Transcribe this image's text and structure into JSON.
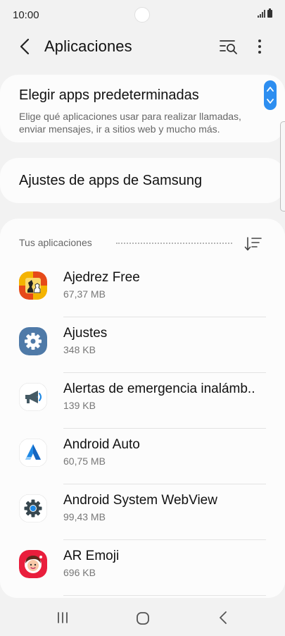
{
  "status_bar": {
    "time": "10:00"
  },
  "header": {
    "back_icon": "back-arrow-icon",
    "title": "Aplicaciones",
    "search_icon": "search-list-icon",
    "more_icon": "more-vert-icon"
  },
  "default_apps": {
    "title": "Elegir apps predeterminadas",
    "description": "Elige qué aplicaciones usar para realizar llamadas, enviar mensajes, ir a sitios web y mucho más."
  },
  "samsung_apps": {
    "title": "Ajustes de apps de Samsung"
  },
  "apps_section": {
    "title": "Tus aplicaciones",
    "sort_icon": "sort-icon",
    "items": [
      {
        "name": "Ajedrez Free",
        "size": "67,37 MB",
        "icon": "chess-icon"
      },
      {
        "name": "Ajustes",
        "size": "348 KB",
        "icon": "settings-gear-icon"
      },
      {
        "name": "Alertas de emergencia inalámb..",
        "size": "139 KB",
        "icon": "megaphone-icon"
      },
      {
        "name": "Android Auto",
        "size": "60,75 MB",
        "icon": "android-auto-icon"
      },
      {
        "name": "Android System WebView",
        "size": "99,43 MB",
        "icon": "webview-gear-icon"
      },
      {
        "name": "AR Emoji",
        "size": "696 KB",
        "icon": "ar-emoji-icon"
      }
    ]
  },
  "nav_bar": {
    "recents_icon": "recents-icon",
    "home_icon": "home-icon",
    "back_icon": "nav-back-icon"
  },
  "colors": {
    "background": "#f2f2f2",
    "card": "#fcfcfc",
    "accent_blue": "#2d8ef0"
  }
}
